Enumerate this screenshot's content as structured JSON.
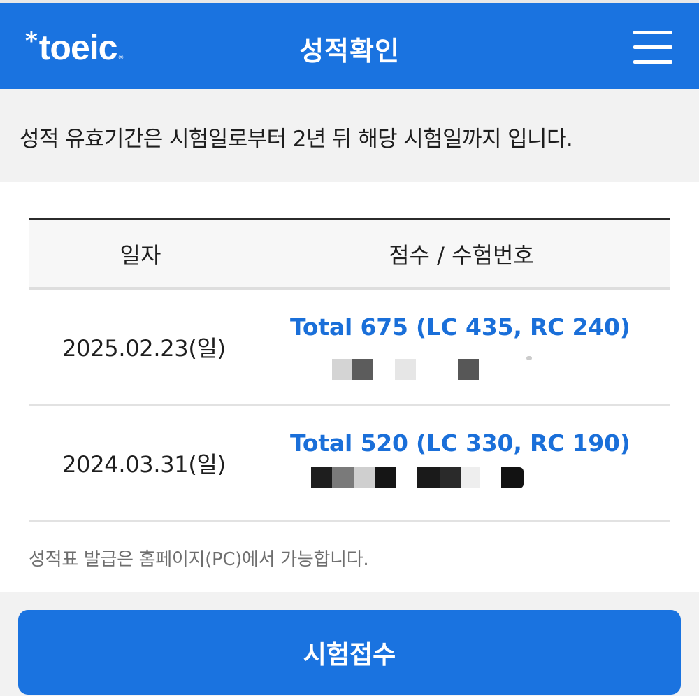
{
  "header": {
    "logo_star": "*",
    "logo_text": "toeic",
    "logo_mark": "®",
    "title": "성적확인",
    "menu_icon": "hamburger-menu-icon"
  },
  "notice": {
    "text": "성적 유효기간은 시험일로부터 2년 뒤 해당 시험일까지 입니다."
  },
  "table": {
    "columns": [
      "일자",
      "점수 / 수험번호"
    ],
    "rows": [
      {
        "date": "2025.02.23(일)",
        "score": "Total 675 (LC 435, RC 240)",
        "registration_number": "redacted"
      },
      {
        "date": "2024.03.31(일)",
        "score": "Total 520 (LC 330, RC 190)",
        "registration_number": "redacted"
      }
    ]
  },
  "footnote": "성적표 발급은 홈페이지(PC)에서 가능합니다.",
  "apply_button": {
    "label": "시험접수"
  },
  "colors": {
    "brand_blue": "#1a73e0",
    "score_blue": "#1a6fd9",
    "band_gray": "#f2f2f2"
  }
}
